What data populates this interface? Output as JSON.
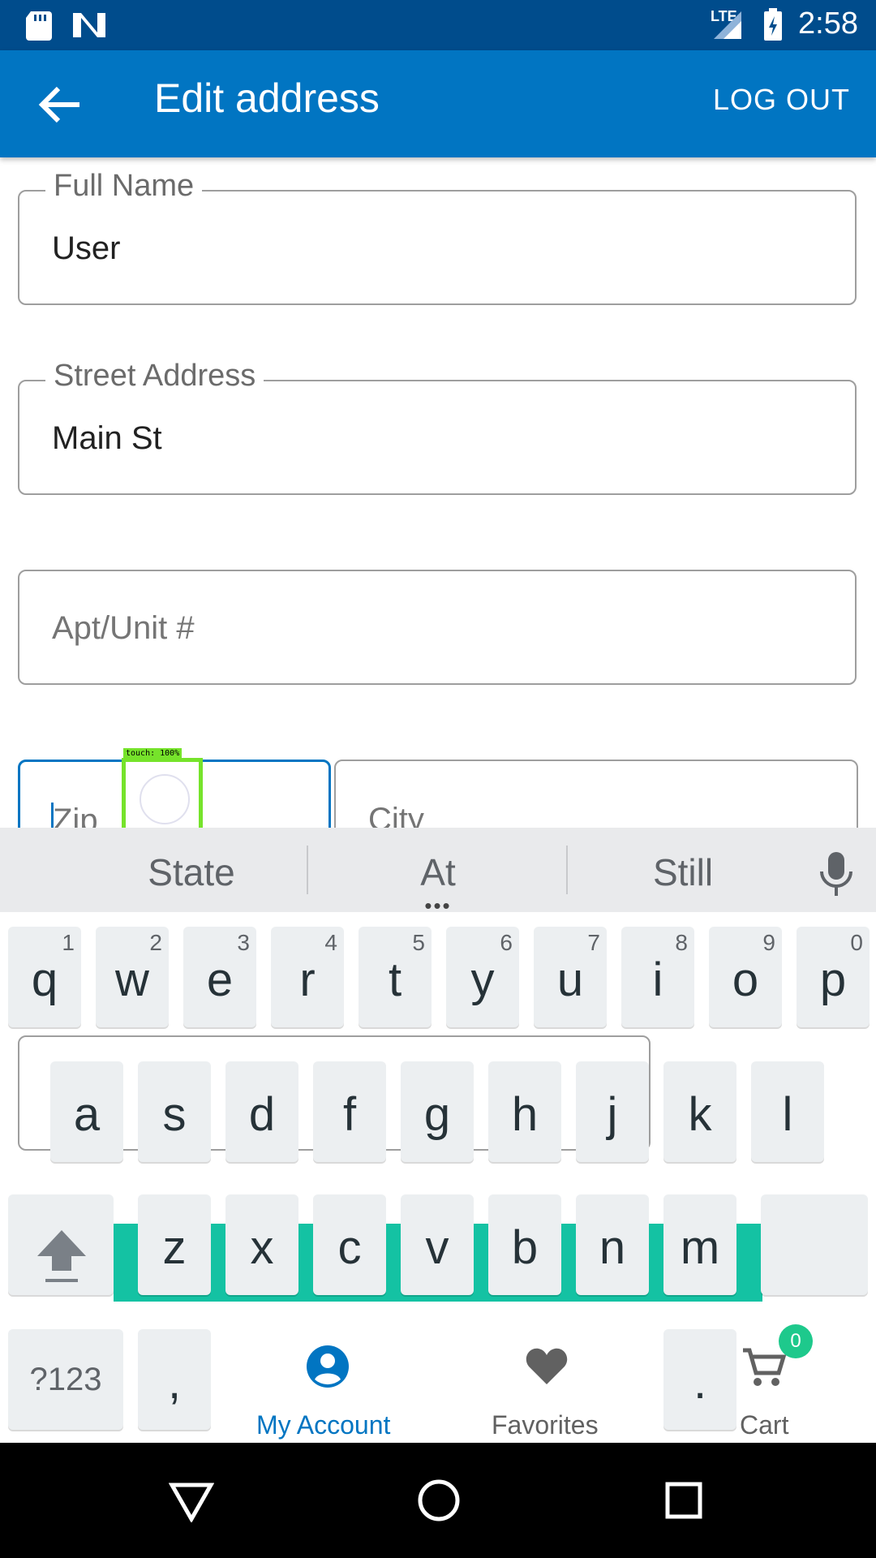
{
  "status_bar": {
    "time": "2:58",
    "network": "LTE",
    "icons": [
      "sd-card-icon",
      "n-logo-icon",
      "signal-icon",
      "battery-charging-icon"
    ]
  },
  "app_bar": {
    "title": "Edit address",
    "logout_label": "LOG OUT",
    "back_icon": "arrow-left-icon"
  },
  "form": {
    "full_name": {
      "label": "Full Name",
      "value": "User"
    },
    "street_address": {
      "label": "Street Address",
      "value": "Main St"
    },
    "apt_unit": {
      "placeholder": "Apt/Unit #"
    },
    "zip": {
      "placeholder": "Zip"
    },
    "city": {
      "placeholder": "City"
    }
  },
  "touch_overlay": {
    "label": "touch: 100%"
  },
  "keyboard": {
    "suggestions": [
      "State",
      "At",
      "Still"
    ],
    "row1": [
      {
        "key": "q",
        "hint": "1"
      },
      {
        "key": "w",
        "hint": "2"
      },
      {
        "key": "e",
        "hint": "3"
      },
      {
        "key": "r",
        "hint": "4"
      },
      {
        "key": "t",
        "hint": "5"
      },
      {
        "key": "y",
        "hint": "6"
      },
      {
        "key": "u",
        "hint": "7"
      },
      {
        "key": "i",
        "hint": "8"
      },
      {
        "key": "o",
        "hint": "9"
      },
      {
        "key": "p",
        "hint": "0"
      }
    ],
    "row2": [
      "a",
      "s",
      "d",
      "f",
      "g",
      "h",
      "j",
      "k",
      "l"
    ],
    "row3": [
      "z",
      "x",
      "c",
      "v",
      "b",
      "n",
      "m"
    ],
    "symbols_label": "?123",
    "comma_label": ",",
    "period_label": "."
  },
  "bottom_nav": {
    "items": [
      {
        "label": "My Account",
        "icon": "account-circle-icon",
        "active": true
      },
      {
        "label": "Favorites",
        "icon": "heart-icon"
      },
      {
        "label": "Cart",
        "icon": "cart-icon",
        "badge": "0"
      }
    ]
  },
  "colors": {
    "primary": "#0175c2",
    "status_bar": "#004c8c",
    "badge": "#1ec98c",
    "teal": "#14c2a3"
  }
}
